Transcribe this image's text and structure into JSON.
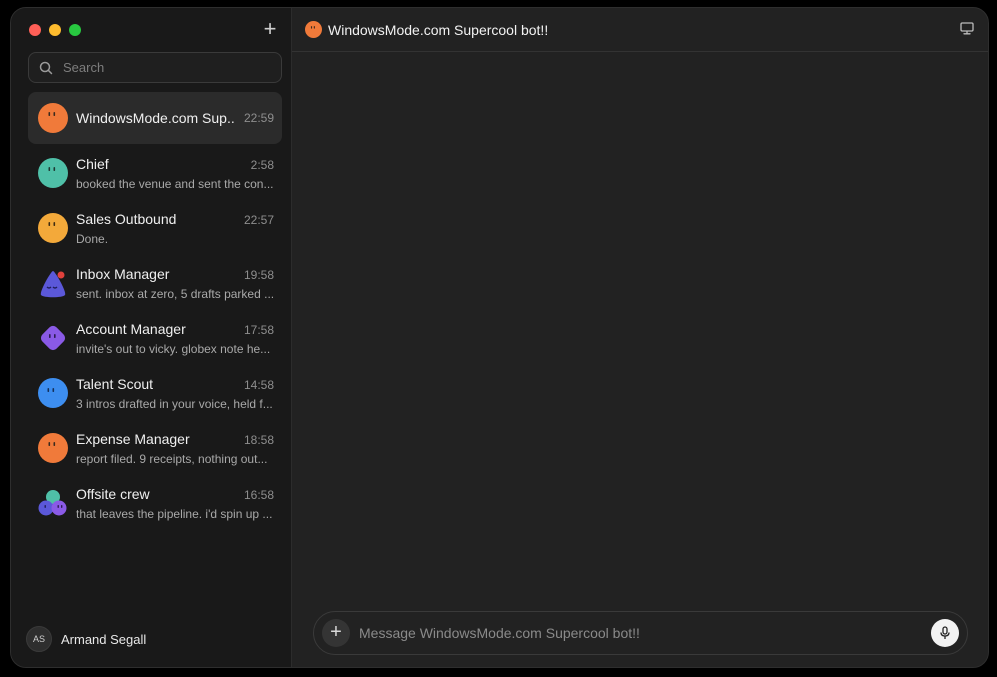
{
  "app": {
    "new_chat_label": "+",
    "search_placeholder": "Search"
  },
  "colors": {
    "orange": "#f07a3a",
    "teal": "#4fc0a8",
    "amber": "#f3a93a",
    "indigo": "#5b58d9",
    "violet": "#8a5ae6",
    "blue": "#3d8ef0"
  },
  "chats": [
    {
      "name": "WindowsMode.com Sup...",
      "time": "22:59",
      "preview": "",
      "avatar": "orange-blob-icon"
    },
    {
      "name": "Chief",
      "time": "2:58",
      "preview": "booked the venue and sent the con...",
      "avatar": "teal-blob-icon"
    },
    {
      "name": "Sales Outbound",
      "time": "22:57",
      "preview": "Done.",
      "avatar": "amber-blob-icon"
    },
    {
      "name": "Inbox Manager",
      "time": "19:58",
      "preview": "sent. inbox at zero, 5 drafts parked ...",
      "avatar": "indigo-triangle-icon"
    },
    {
      "name": "Account Manager",
      "time": "17:58",
      "preview": "invite's out to vicky. globex note he...",
      "avatar": "violet-diamond-icon"
    },
    {
      "name": "Talent Scout",
      "time": "14:58",
      "preview": "3 intros drafted in your voice, held f...",
      "avatar": "blue-blob-icon"
    },
    {
      "name": "Expense Manager",
      "time": "18:58",
      "preview": "report filed. 9 receipts, nothing out...",
      "avatar": "orange-blob-icon"
    },
    {
      "name": "Offsite crew",
      "time": "16:58",
      "preview": "that leaves the pipeline. i'd spin up ...",
      "avatar": "group-icon"
    }
  ],
  "user": {
    "initials": "AS",
    "name": "Armand Segall"
  },
  "conversation": {
    "title": "WindowsMode.com Supercool bot!!",
    "composer_placeholder": "Message WindowsMode.com Supercool bot!!"
  }
}
